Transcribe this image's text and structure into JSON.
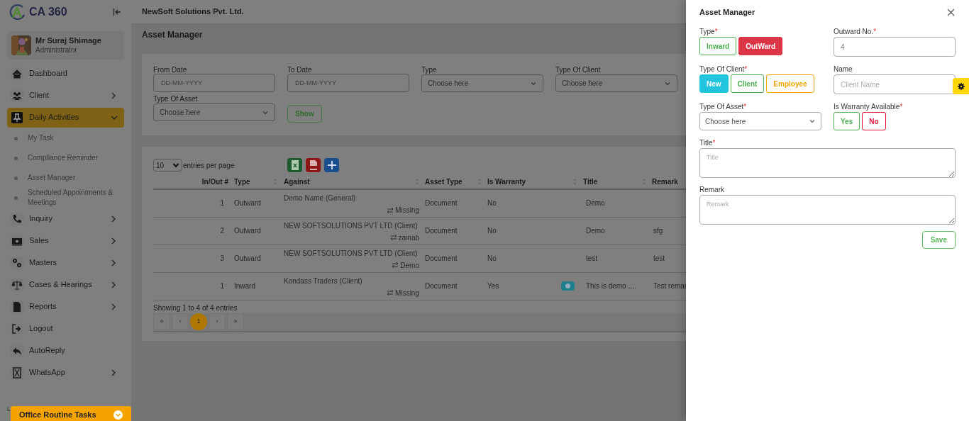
{
  "sidebar": {
    "logo": "CA 360",
    "user": {
      "name": "Mr Suraj Shimage",
      "role": "Administrator"
    },
    "nav": [
      {
        "label": "Dashboard"
      },
      {
        "label": "Client",
        "expanded": false
      },
      {
        "label": "Daily Activities",
        "expanded": true,
        "selected": true,
        "children": [
          {
            "label": "My Task"
          },
          {
            "label": "Compliance Reminder"
          },
          {
            "label": "Asset Manager"
          },
          {
            "label": "Scheduled Appointments & Meetings"
          }
        ]
      },
      {
        "label": "Inquiry",
        "expanded": false
      },
      {
        "label": "Sales",
        "expanded": false
      },
      {
        "label": "Masters",
        "expanded": false
      },
      {
        "label": "Cases & Hearings",
        "expanded": false
      },
      {
        "label": "Reports",
        "expanded": false
      },
      {
        "label": "Logout"
      },
      {
        "label": "AutoReply"
      },
      {
        "label": "WhatsApp",
        "expanded": false
      }
    ],
    "footer_label": "L",
    "routine_tasks": "Office Routine Tasks"
  },
  "topbar": {
    "company": "NewSoft Solutions Pvt. Ltd."
  },
  "page_title": "Asset Manager",
  "filters": [
    {
      "kind": "date",
      "label": "From Date",
      "placeholder": "DD-MM-YYYY"
    },
    {
      "kind": "date",
      "label": "To Date",
      "placeholder": "DD-MM-YYYY"
    },
    {
      "kind": "select",
      "label": "Type",
      "placeholder": "Choose here"
    },
    {
      "kind": "select",
      "label": "Type Of Client",
      "placeholder": "Choose here"
    },
    {
      "kind": "select",
      "label": "Type Of Asset",
      "placeholder": "Choose here"
    }
  ],
  "show_button": "Show",
  "table": {
    "page_size": "10",
    "page_size_label": "entries per page",
    "columns": [
      {
        "label": "In/Out #",
        "sortable": false
      },
      {
        "label": "Type",
        "sortable": true
      },
      {
        "label": "Against",
        "sortable": true
      },
      {
        "label": "Asset Type",
        "sortable": true
      },
      {
        "label": "Is Warranty",
        "sortable": true
      },
      {
        "label": "Title",
        "sortable": true
      },
      {
        "label": "Remark",
        "sortable": false
      }
    ],
    "rows": [
      {
        "in_out": "1",
        "type": "Outward",
        "against": "Demo Name (General)",
        "assignee": "Missing",
        "asset_type": "Document",
        "warranty": "No",
        "info": false,
        "title": "Demo"
      },
      {
        "in_out": "2",
        "type": "Outward",
        "against": "NEW SOFTSOLUTIONS PVT LTD (Client)",
        "assignee": "zainab",
        "asset_type": "Document",
        "warranty": "No",
        "info": false,
        "title": "Demo",
        "remark": "sfg"
      },
      {
        "in_out": "3",
        "type": "Outward",
        "against": "NEW SOFTSOLUTIONS PVT LTD (Client)",
        "assignee": "Demo",
        "asset_type": "Document",
        "warranty": "No",
        "info": false,
        "title": "test",
        "remark": "test"
      },
      {
        "in_out": "1",
        "type": "Inward",
        "against": "Kondass Traders (Client)",
        "assignee": "Missing",
        "asset_type": "Document",
        "warranty": "Yes",
        "info": true,
        "title": "This is demo ....",
        "remark": "Test remar"
      }
    ],
    "summary": "Showing 1 to 4 of 4 entries",
    "pagination": [
      {
        "label": "«",
        "selected": false
      },
      {
        "label": "‹",
        "selected": false
      },
      {
        "label": "1",
        "selected": true
      },
      {
        "label": "›",
        "selected": false
      },
      {
        "label": "»",
        "selected": false
      }
    ]
  },
  "drawer": {
    "title": "Asset Manager",
    "fields": [
      {
        "kind": "toggle",
        "label": "Type",
        "required": "*",
        "options": [
          {
            "label": "Inward",
            "color": "#4caf50",
            "selected": false
          },
          {
            "label": "OutWard",
            "color": "#dc3545",
            "selected": true
          }
        ]
      },
      {
        "kind": "input",
        "label": "Outward No.",
        "required": "*",
        "value": "4"
      },
      {
        "kind": "toggle",
        "label": "Type Of Client",
        "required": "*",
        "options": [
          {
            "label": "New",
            "color": "#22c5dd",
            "selected": true
          },
          {
            "label": "Client",
            "color": "#4caf50",
            "selected": false
          },
          {
            "label": "Employee",
            "color": "#f0a500",
            "selected": false
          }
        ]
      },
      {
        "kind": "input",
        "label": "Name",
        "placeholder": "Client Name"
      },
      {
        "kind": "select",
        "label": "Type Of Asset",
        "required": "*",
        "placeholder": "Choose here"
      },
      {
        "kind": "toggle",
        "label": "Is Warranty Available",
        "required": "*",
        "options": [
          {
            "label": "Yes",
            "color": "#4caf50",
            "selected": false
          },
          {
            "label": "No",
            "color": "#e0103a",
            "selected": false
          }
        ]
      },
      {
        "kind": "textarea",
        "label": "Title",
        "required": "*",
        "placeholder": "Title"
      },
      {
        "kind": "textarea",
        "label": "Remark",
        "placeholder": "Remark"
      }
    ],
    "save_button": "Save"
  }
}
